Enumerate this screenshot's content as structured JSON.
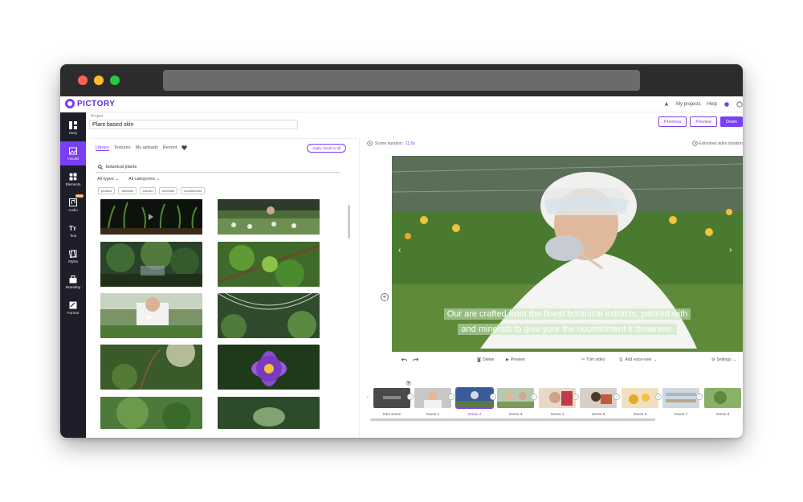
{
  "app": {
    "logo_text": "PICTORY"
  },
  "topnav": {
    "my_projects": "My projects",
    "help": "Help"
  },
  "project": {
    "label": "Project",
    "name": "Plant based skin"
  },
  "header_buttons": {
    "previous": "Previous",
    "preview": "Preview",
    "download": "Down"
  },
  "sidebar": {
    "items": [
      {
        "label": "Story",
        "icon": "story-icon"
      },
      {
        "label": "Visuals",
        "icon": "visuals-icon",
        "active": true
      },
      {
        "label": "Elements",
        "icon": "elements-icon"
      },
      {
        "label": "Audio",
        "icon": "audio-icon",
        "badge": "NEW"
      },
      {
        "label": "Text",
        "icon": "text-icon"
      },
      {
        "label": "Styles",
        "icon": "styles-icon"
      },
      {
        "label": "Branding",
        "icon": "branding-icon"
      },
      {
        "label": "Format",
        "icon": "format-icon"
      }
    ]
  },
  "library": {
    "tabs": [
      "Library",
      "Textures",
      "My uploads",
      "Recent"
    ],
    "apply_button": "Apply visual to all",
    "search_value": "botanical plants",
    "filter_type": "All types",
    "filter_category": "All categories",
    "chips": [
      "product",
      "vitamins",
      "extract",
      "minerals",
      "nourishment"
    ]
  },
  "scene": {
    "duration_label": "Scene duration:",
    "duration_value": "11.5s",
    "estimated_label": "Estimated video duration"
  },
  "caption": {
    "line1": "Our              are crafted from the finest botanical extracts, packed with",
    "line2": "and minerals to give your         the nourishment it deserves."
  },
  "video_controls": {
    "delete": "Delete",
    "preview": "Preview",
    "trim": "Trim video",
    "voice": "Add voice-over",
    "settings": "Settings"
  },
  "timeline": {
    "scenes": [
      "Intro scene",
      "Scene 1",
      "Scene 2",
      "Scene 3",
      "Scene 4",
      "Scene 5",
      "Scene 6",
      "Scene 7",
      "Scene 8"
    ],
    "active_index": 2
  },
  "colors": {
    "accent": "#7a3ff2",
    "sidebar": "#1e1e2a"
  }
}
